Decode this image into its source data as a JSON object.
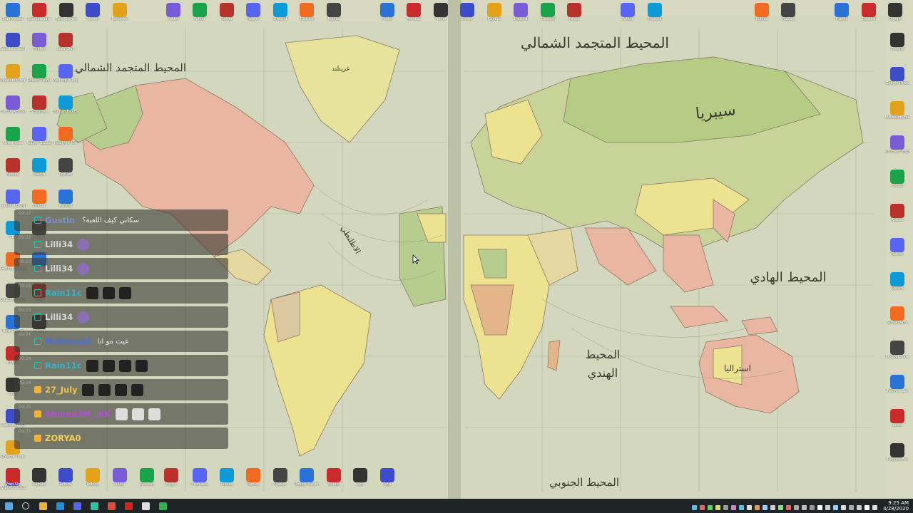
{
  "wallpaper": {
    "left_page_title": "المحيط المتجمد الشمالي",
    "right_page_title": "المحيط المتجمد الشمالي",
    "labels": {
      "siberia": "سيبريا",
      "pacific": "المحيط الهادي",
      "indian_ocean": "المحيط الهندي",
      "southern": "المحيط الجنوبي",
      "australia": "استراليا",
      "greenland": "غرينلند",
      "atlantic": "الاطلنطي"
    }
  },
  "desktop": {
    "top_row": [
      "TeamViewer",
      "Wondershare",
      "Epic Games",
      "Steam",
      "Recorder",
      "Folder",
      "Folder",
      "Setup",
      "Roblox",
      "Discord",
      "Discord",
      "Roblox",
      "Folder",
      "Acrobat",
      "Folder",
      "Folder",
      "CapCut",
      "Discord",
      "Discord",
      "Folder",
      "Folder",
      "Discord",
      "Roblox",
      "Roblox",
      "Firefox",
      "Discord",
      "Google"
    ],
    "left_col": [
      "Wondershare PDFelement",
      "Malwarebytes",
      "Fast Downloader",
      "Streamlabs",
      "Spotify",
      "Personal Browser",
      "VLC",
      "Getting Started",
      "Quantum Zone",
      "Host Config",
      "HELLO",
      "Core",
      "LogiBoost HD",
      "Chrome Tools",
      "Wrap Simulator"
    ],
    "second_col": [
      "Firefox",
      "Roblox Player",
      "Streamer",
      "Roblox Studio",
      "Steam",
      "Firefox",
      "Setup",
      "HELLO",
      "Core",
      "Config"
    ],
    "third_col": [
      "Local Doll",
      "Pushing It Together",
      "Human Fall Flat",
      "Ready or Not",
      "Outlast",
      "Ascend"
    ],
    "right_col": [
      "Google",
      "Google Drive",
      "Malwarebytes",
      "Microsoft Edge",
      "Setup",
      "Roblox",
      "Roblox",
      "Steam",
      "Streamlabs",
      "Wondershare",
      "Recycle Bin",
      "Lock",
      "Recycle Bin"
    ],
    "bottom_row": [
      "Wrap Sim",
      "CapCut",
      "Roblox",
      "Roblox",
      "Folder",
      "Acrobat",
      "Folder",
      "Premiere",
      "Roblox",
      "Roblox",
      "Roblox",
      "Roblox Player",
      "Studio",
      "App",
      "App",
      "Roblox",
      "7-Zip"
    ]
  },
  "chat": {
    "messages": [
      {
        "time": "09:22",
        "user": "Gustin",
        "user_color": "#7d8fd0",
        "text": "سكاني كيف اللعبة؟",
        "emotes": []
      },
      {
        "time": "09:22",
        "user": "Lilli34",
        "user_color": "#d8d8d8",
        "text": "",
        "emotes": [
          "p"
        ]
      },
      {
        "time": "09:22",
        "user": "Lilli34",
        "user_color": "#d8d8d8",
        "text": "",
        "emotes": [
          "p"
        ]
      },
      {
        "time": "09:23",
        "user": "Rain11c",
        "user_color": "#33b4c9",
        "text": "",
        "emotes": [
          "d",
          "d",
          "d"
        ]
      },
      {
        "time": "09:23",
        "user": "Lilli34",
        "user_color": "#d8d8d8",
        "text": "",
        "emotes": [
          "p"
        ]
      },
      {
        "time": "09:24",
        "user": "Mahmoud",
        "user_color": "#4a6fe0",
        "text": "غيث مو انا",
        "emotes": []
      },
      {
        "time": "09:24",
        "user": "Rain11c",
        "user_color": "#33b4c9",
        "text": "",
        "emotes": [
          "d",
          "d",
          "d",
          "d"
        ]
      },
      {
        "time": "09:24",
        "user": "27_July",
        "user_color": "#f0c24b",
        "text": "",
        "emotes": [
          "d",
          "d",
          "d",
          "d"
        ]
      },
      {
        "time": "09:25",
        "user": "Ahmed3M_.KK",
        "user_color": "#b14fd4",
        "text": "",
        "emotes": [
          "w",
          "w",
          "w"
        ]
      },
      {
        "time": "09:25",
        "user": "ZORYA0",
        "user_color": "#f4d05a",
        "text": "",
        "emotes": []
      }
    ]
  },
  "taskbar": {
    "apps": [
      "start",
      "search",
      "file-explorer",
      "edge",
      "discord",
      "streamlabs",
      "chrome",
      "acrobat",
      "roblox",
      "roblox-studio"
    ],
    "clock_time": "9:25 AM",
    "clock_date": "4/28/2020"
  }
}
